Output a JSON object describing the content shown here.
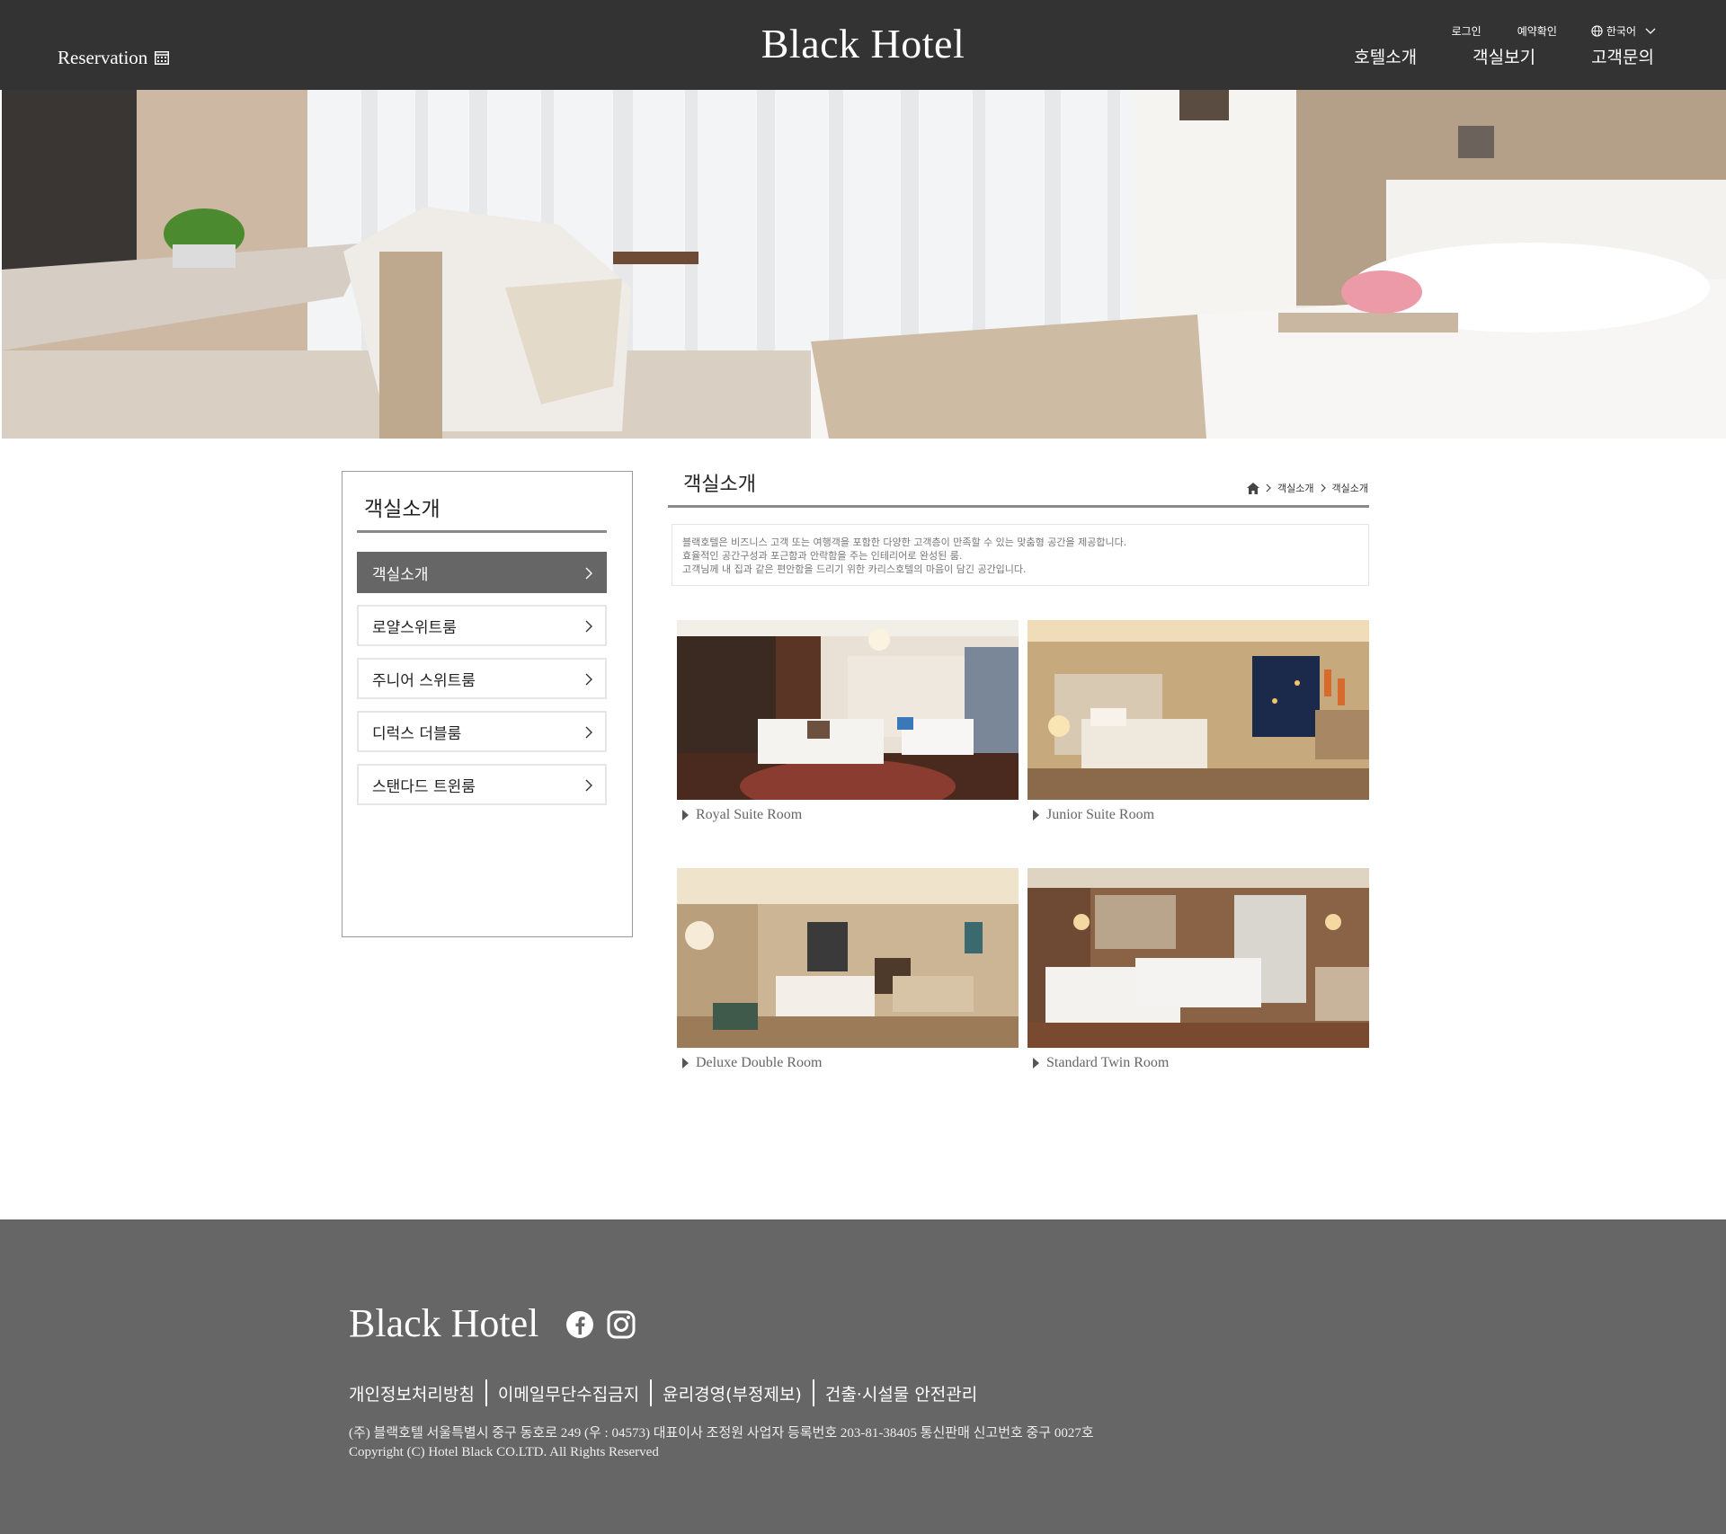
{
  "header": {
    "reservation_label": "Reservation",
    "logo": "Black Hotel",
    "util": {
      "login": "로그인",
      "booking_check": "예약확인",
      "language": "한국어"
    },
    "nav": [
      "호텔소개",
      "객실보기",
      "고객문의"
    ]
  },
  "sidebar": {
    "title": "객실소개",
    "items": [
      {
        "label": "객실소개",
        "active": true
      },
      {
        "label": "로얄스위트룸",
        "active": false
      },
      {
        "label": "주니어 스위트룸",
        "active": false
      },
      {
        "label": "디럭스 더블룸",
        "active": false
      },
      {
        "label": "스탠다드 트윈룸",
        "active": false
      }
    ]
  },
  "content": {
    "title": "객실소개",
    "breadcrumb": [
      "객실소개",
      "객실소개"
    ],
    "description": [
      "블랙호텔은 비즈니스 고객 또는 여행객을 포함한 다양한 고객층이 만족할 수 있는 맞춤형 공간을 제공합니다.",
      "효율적인 공간구성과 포근함과 안락함을 주는 인테리어로 완성된 룸.",
      "고객님께 내 집과 같은 편안함을 드리기 위한 카리스호텔의 마음이 담긴 공간입니다."
    ],
    "rooms": [
      {
        "name": "Royal Suite Room"
      },
      {
        "name": "Junior Suite Room"
      },
      {
        "name": "Deluxe Double Room"
      },
      {
        "name": "Standard Twin Room"
      }
    ]
  },
  "footer": {
    "logo": "Black Hotel",
    "links": [
      "개인정보처리방침",
      "이메일무단수집금지",
      "윤리경영(부정제보)",
      "건출·시설물 안전관리"
    ],
    "address": "(주) 블랙호텔 서울특별시 중구 동호로 249 (우 : 04573) 대표이사 조정원   사업자 등록번호  203-81-38405 통신판매 신고번호 중구 0027호",
    "copyright": "Copyright (C) Hotel Black CO.LTD. All Rights Reserved"
  },
  "colors": {
    "header_bg": "#333333",
    "footer_bg": "#666666",
    "active_menu": "#666666"
  }
}
